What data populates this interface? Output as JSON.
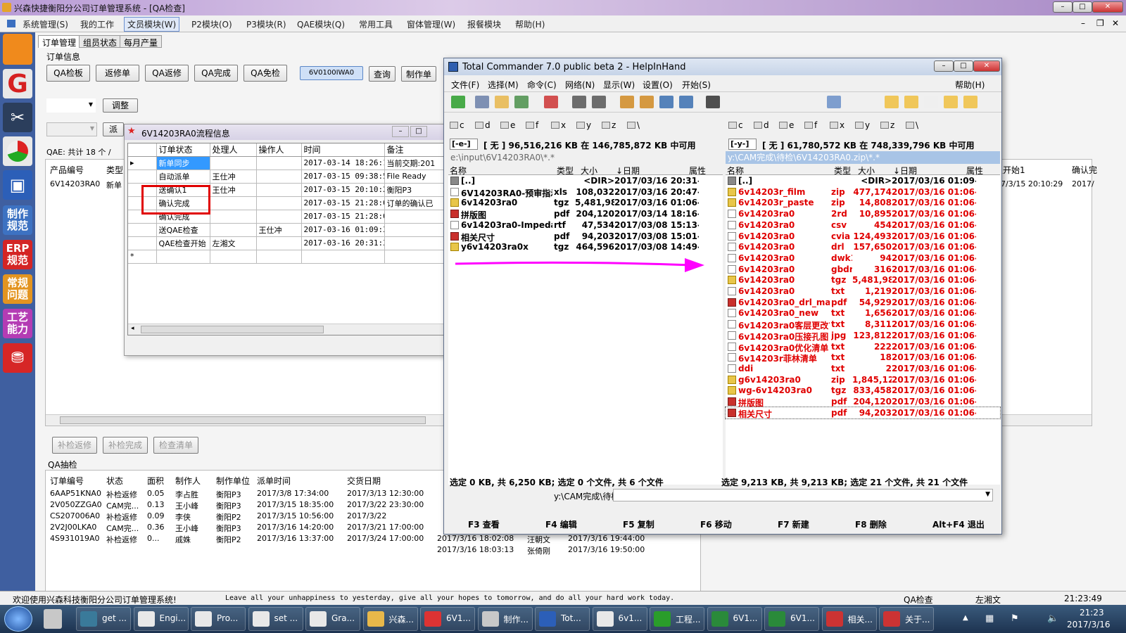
{
  "app": {
    "title": "兴森快捷衡阳分公司订单管理系统 - [QA检查]"
  },
  "menu": [
    "系统管理(S)",
    "我的工作",
    "文员模块(W)",
    "P2模块(O)",
    "P3模块(R)",
    "QAE模块(Q)",
    "常用工具",
    "窗体管理(W)",
    "报餐模块",
    "帮助(H)"
  ],
  "left_buttons": [
    "制作规范",
    "ERP规范",
    "常规问题",
    "工艺能力"
  ],
  "tabs": [
    "订单管理",
    "组员状态",
    "每月产量"
  ],
  "order_info": "订单信息",
  "top_buttons": [
    "QA检板",
    "返修单",
    "QA返修",
    "QA完成",
    "QA免检",
    "6V0100IWA0",
    "查询",
    "制作单"
  ],
  "adjust": "调整",
  "dispatch": "派",
  "qae_total": "QAE: 共计 18 个 /",
  "product_table": {
    "headers": [
      "产品编号",
      "类型"
    ],
    "row": [
      "6V14203RA0",
      "新单"
    ]
  },
  "right_cols": {
    "headers": [
      "确认开始1",
      "确认完"
    ],
    "row": [
      "2017/3/15 20:10:29",
      "2017/"
    ]
  },
  "bottom_buttons": [
    "补检返修",
    "补检完成",
    "检查清单"
  ],
  "qa_sample": "QA抽检",
  "qa_table": {
    "headers": [
      "订单编号",
      "状态",
      "面积",
      "制作人",
      "制作单位",
      "派单时间",
      "交货日期"
    ],
    "rows": [
      [
        "6AAP51KNA0",
        "补检返修",
        "0.05",
        "李占胜",
        "衡阳P3",
        "2017/3/8 17:34:00",
        "2017/3/13 12:30:00"
      ],
      [
        "2V050ZZGA0",
        "CAM完...",
        "0.13",
        "王小峰",
        "衡阳P3",
        "2017/3/15 18:35:00",
        "2017/3/22 23:30:00"
      ],
      [
        "CS207006A0",
        "补检返修",
        "0.09",
        "李侠",
        "衡阳P2",
        "2017/3/15 10:56:00",
        "2017/3/22"
      ],
      [
        "2V2J00LKA0",
        "CAM完...",
        "0.36",
        "王小峰",
        "衡阳P3",
        "2017/3/16 14:20:00",
        "2017/3/21 17:00:00"
      ],
      [
        "4S931019A0",
        "补检返修",
        "0...",
        "戚姝",
        "衡阳P2",
        "2017/3/16 13:37:00",
        "2017/3/24 17:00:00"
      ]
    ],
    "extra": [
      [
        "2017/3/16 18:02:08",
        "汪朝文",
        "2017/3/16 19:44:00"
      ],
      [
        "2017/3/16 18:03:13",
        "张倚刚",
        "2017/3/16 19:50:00"
      ]
    ]
  },
  "flow": {
    "title": "6V14203RA0流程信息",
    "headers": [
      "订单状态",
      "处理人",
      "操作人",
      "时间",
      "备注"
    ],
    "rows": [
      [
        "新单同步",
        "",
        "",
        "2017-03-14 18:26:19",
        "当前交期:201"
      ],
      [
        "自动派单",
        "王仕冲",
        "",
        "2017-03-15 09:38:54",
        "File Ready"
      ],
      [
        "送确认1",
        "王仕冲",
        "",
        "2017-03-15 20:10:29",
        "衡阳P3"
      ],
      [
        "确认完成",
        "",
        "",
        "2017-03-15 21:28:01",
        "订单的确认已"
      ],
      [
        "确认完成",
        "",
        "",
        "2017-03-15 21:28:03",
        ""
      ],
      [
        "送QAE检查",
        "",
        "王仕冲",
        "2017-03-16 01:09:39",
        ""
      ],
      [
        "QAE检查开始",
        "左湘文",
        "",
        "2017-03-16 20:31:39",
        ""
      ]
    ],
    "newrow": "*"
  },
  "tc": {
    "title": "Total Commander 7.0 public beta 2 - HelpInHand",
    "menu": [
      "文件(F)",
      "选择(M)",
      "命令(C)",
      "网络(N)",
      "显示(W)",
      "设置(O)",
      "开始(S)",
      "帮助(H)"
    ],
    "drives": [
      "c",
      "d",
      "e",
      "f",
      "x",
      "y",
      "z",
      "\\"
    ],
    "left": {
      "drive": "[-e-]",
      "free": "[ 无 ]  96,516,216 KB 在 146,785,872 KB 中可用",
      "path": "e:\\input\\6V14203RA0\\*.*",
      "headers": [
        "名称",
        "类型",
        "大小",
        "↓日期",
        "属性"
      ],
      "files": [
        [
          "[..]",
          "",
          "<DIR>",
          "2017/03/16 20:31—",
          "",
          "up"
        ],
        [
          "6V14203RA0-预审指示",
          "xls",
          "108,032",
          "2017/03/16 20:47-a-",
          "",
          "doc"
        ],
        [
          "6v14203ra0",
          "tgz",
          "5,481,988",
          "2017/03/16 01:06-a-",
          "",
          "arc"
        ],
        [
          "拼版图",
          "pdf",
          "204,120",
          "2017/03/14 18:16-a-",
          "",
          "pdf"
        ],
        [
          "6v14203ra0-Impedanc..",
          "rtf",
          "47,534",
          "2017/03/08 15:13-a-",
          "",
          "doc"
        ],
        [
          "相关尺寸",
          "pdf",
          "94,203",
          "2017/03/08 15:01-a-",
          "",
          "pdf"
        ],
        [
          "y6v14203ra0x",
          "tgz",
          "464,596",
          "2017/03/08 14:49-a-",
          "",
          "arc"
        ]
      ],
      "status": "选定 0 KB, 共 6,250 KB; 选定 0 个文件, 共 6 个文件"
    },
    "right": {
      "drive": "[-y-]",
      "free": "[ 无 ]  61,780,572 KB 在 748,339,796 KB 中可用",
      "path": "y:\\CAM完成\\待检\\6V14203RA0.zip\\*.*",
      "headers": [
        "名称",
        "类型",
        "大小",
        "↓日期",
        "属性"
      ],
      "files": [
        [
          "[..]",
          "",
          "<DIR>",
          "2017/03/16 01:09—",
          "",
          "up"
        ],
        [
          "6v14203r_film",
          "zip",
          "477,174",
          "2017/03/16 01:06-a-",
          "",
          "arc"
        ],
        [
          "6v14203r_paste",
          "zip",
          "14,808",
          "2017/03/16 01:06-a-",
          "",
          "arc"
        ],
        [
          "6v14203ra0",
          "2rd",
          "10,895",
          "2017/03/16 01:06-a-",
          "",
          "doc"
        ],
        [
          "6v14203ra0",
          "csv",
          "454",
          "2017/03/16 01:06-a-",
          "",
          "doc"
        ],
        [
          "6v14203ra0",
          "cvia",
          "124,493",
          "2017/03/16 01:06-a-",
          "",
          "doc"
        ],
        [
          "6v14203ra0",
          "drl",
          "157,650",
          "2017/03/16 01:06-a-",
          "",
          "doc"
        ],
        [
          "6v14203ra0",
          "dwk1",
          "94",
          "2017/03/16 01:06-a-",
          "",
          "doc"
        ],
        [
          "6v14203ra0",
          "gbdrl",
          "316",
          "2017/03/16 01:06-a-",
          "",
          "doc"
        ],
        [
          "6v14203ra0",
          "tgz",
          "5,481,988",
          "2017/03/16 01:06-a-",
          "",
          "arc"
        ],
        [
          "6v14203ra0",
          "txt",
          "1,219",
          "2017/03/16 01:06-a-",
          "",
          "doc"
        ],
        [
          "6v14203ra0_drl_map",
          "pdf",
          "54,929",
          "2017/03/16 01:06-a-",
          "",
          "pdf"
        ],
        [
          "6v14203ra0_new",
          "txt",
          "1,656",
          "2017/03/16 01:06-a-",
          "",
          "doc"
        ],
        [
          "6v14203ra0客层更改?..",
          "txt",
          "8,311",
          "2017/03/16 01:06-a-",
          "",
          "doc"
        ],
        [
          "6v14203ra0压接孔图",
          "jpg",
          "123,812",
          "2017/03/16 01:06-a-",
          "",
          "doc"
        ],
        [
          "6v14203ra0优化清单",
          "txt",
          "222",
          "2017/03/16 01:06-a-",
          "",
          "doc"
        ],
        [
          "6v14203r菲林清单",
          "txt",
          "18",
          "2017/03/16 01:06-a-",
          "",
          "doc"
        ],
        [
          "ddi",
          "txt",
          "2",
          "2017/03/16 01:06-a-",
          "",
          "doc"
        ],
        [
          "g6v14203ra0",
          "zip",
          "1,845,127",
          "2017/03/16 01:06-a-",
          "",
          "arc"
        ],
        [
          "wg-6v14203ra0",
          "tgz",
          "833,458",
          "2017/03/16 01:06-a-",
          "",
          "arc"
        ],
        [
          "拼版图",
          "pdf",
          "204,120",
          "2017/03/16 01:06-a-",
          "",
          "pdf"
        ],
        [
          "相关尺寸",
          "pdf",
          "94,203",
          "2017/03/16 01:06-a-",
          "",
          "pdf"
        ]
      ],
      "status": "选定 9,213 KB, 共 9,213 KB; 选定 21 个文件, 共 21 个文件"
    },
    "cmdpath": "y:\\CAM完成\\待检>",
    "fkeys": [
      "F3 查看",
      "F4 编辑",
      "F5 复制",
      "F6 移动",
      "F7 新建",
      "F8 删除",
      "Alt+F4 退出"
    ]
  },
  "statusbar": {
    "welcome": "欢迎使用兴森科技衡阳分公司订单管理系统!",
    "motto": "Leave all your unhappiness to yesterday, give all your hopes to tomorrow, and do all your hard work today.",
    "module": "QA检查",
    "user": "左湘文",
    "time": "21:23:49"
  },
  "taskbar": {
    "items": [
      "get ...",
      "Engi...",
      "Pro...",
      "set ...",
      "Gra...",
      "兴森...",
      "6V1...",
      "制作...",
      "Tot...",
      "6v1...",
      "工程...",
      "6V1...",
      "6V1...",
      "相关...",
      "关于..."
    ],
    "clock": "21:23",
    "date": "2017/3/16"
  },
  "colors": {
    "highlight_box": "#e00000",
    "arrow": "#ff00ff",
    "selected_file": "#e00000",
    "flow_selected": "#3399ff"
  }
}
